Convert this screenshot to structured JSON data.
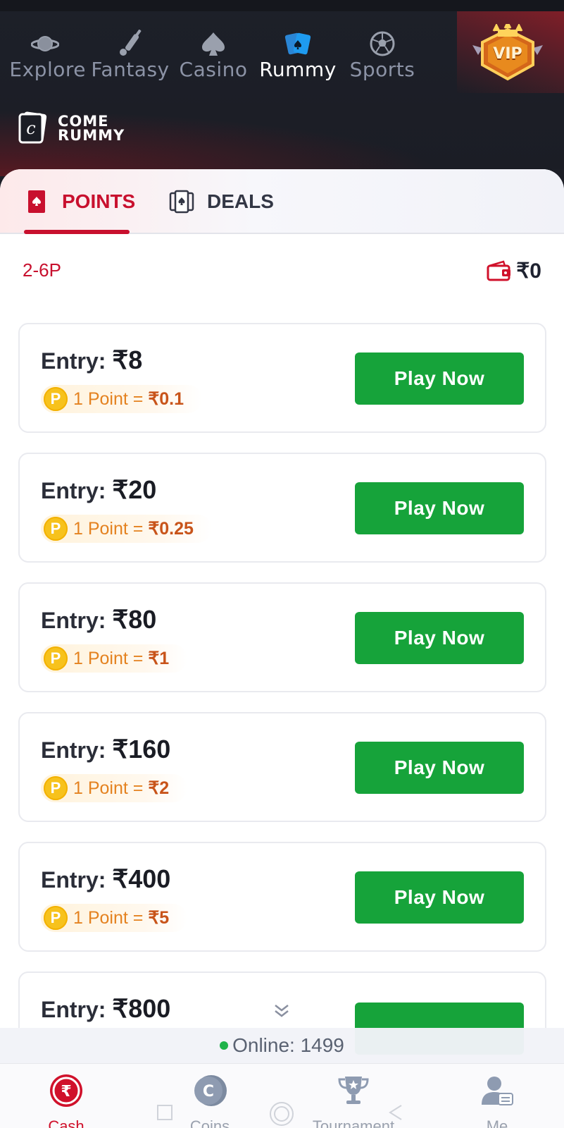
{
  "nav": {
    "items": [
      {
        "label": "Explore",
        "icon": "planet-icon"
      },
      {
        "label": "Fantasy",
        "icon": "bat-icon"
      },
      {
        "label": "Casino",
        "icon": "spade-icon"
      },
      {
        "label": "Rummy",
        "icon": "cards-icon",
        "active": true
      },
      {
        "label": "Sports",
        "icon": "football-icon"
      }
    ],
    "vip_label": "VIP"
  },
  "logo": {
    "line1": "COME",
    "line2": "RUMMY"
  },
  "tabs": [
    {
      "label": "POINTS",
      "active": true
    },
    {
      "label": "DEALS",
      "active": false
    }
  ],
  "player_range": "2-6P",
  "wallet_balance": "₹0",
  "tables": [
    {
      "entry_label": "Entry:",
      "entry": "₹8",
      "rate_label": "1 Point",
      "eq": "=",
      "rate": "₹0.1",
      "button": "Play  Now"
    },
    {
      "entry_label": "Entry:",
      "entry": "₹20",
      "rate_label": "1 Point",
      "eq": "=",
      "rate": "₹0.25",
      "button": "Play  Now"
    },
    {
      "entry_label": "Entry:",
      "entry": "₹80",
      "rate_label": "1 Point",
      "eq": "=",
      "rate": "₹1",
      "button": "Play  Now"
    },
    {
      "entry_label": "Entry:",
      "entry": "₹160",
      "rate_label": "1 Point",
      "eq": "=",
      "rate": "₹2",
      "button": "Play  Now"
    },
    {
      "entry_label": "Entry:",
      "entry": "₹400",
      "rate_label": "1 Point",
      "eq": "=",
      "rate": "₹5",
      "button": "Play  Now"
    },
    {
      "entry_label": "Entry:",
      "entry": "₹800",
      "rate_label": "",
      "eq": "",
      "rate": "",
      "button": ""
    }
  ],
  "online": "Online: 1499",
  "bottom_nav": [
    {
      "label": "Cash",
      "icon": "rupee-icon",
      "active": true
    },
    {
      "label": "Coins",
      "icon": "coin-icon"
    },
    {
      "label": "Tournament",
      "icon": "trophy-icon"
    },
    {
      "label": "Me",
      "icon": "profile-icon"
    }
  ],
  "colors": {
    "accent": "#c8102e",
    "play_button": "#16a33a",
    "coin": "#f7c21c",
    "dark_bg": "#1c1e26"
  }
}
